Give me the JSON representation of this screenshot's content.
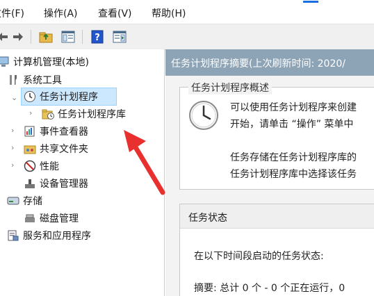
{
  "menubar": {
    "items": [
      "文件(F)",
      "操作(A)",
      "查看(V)",
      "帮助(H)"
    ]
  },
  "toolbar": {
    "buttons": [
      "back-icon",
      "forward-icon",
      "up-folder-icon",
      "show-hide-tree-icon",
      "help-icon",
      "action-pane-icon"
    ]
  },
  "tree": {
    "root": "计算机管理(本地)",
    "system_tools": "系统工具",
    "task_scheduler": "任务计划程序",
    "task_scheduler_library": "任务计划程序库",
    "event_viewer": "事件查看器",
    "shared_folders": "共享文件夹",
    "performance": "性能",
    "device_manager": "设备管理器",
    "storage": "存储",
    "disk_management": "磁盘管理",
    "services_apps": "服务和应用程序"
  },
  "main": {
    "header": "任务计划程序摘要(上次刷新时间: 2020/",
    "overview_title": "任务计划程序概述",
    "overview_line1": "可以使用任务计划程序来创建",
    "overview_line2": "开始，请单击 “操作” 菜单中",
    "overview_line3": "任务存储在任务计划程序库的",
    "overview_line4": "任务计划程序库中选择该任务",
    "status_title": "任务状态",
    "status_line1": "在以下时间段启动的任务状态:",
    "status_line2": "摘要: 总计 0 个 - 0 个正在运行，0"
  },
  "colors": {
    "accent_header": "#8da3b6",
    "selection": "#cce8ff",
    "annotation_arrow": "#e8312f"
  }
}
